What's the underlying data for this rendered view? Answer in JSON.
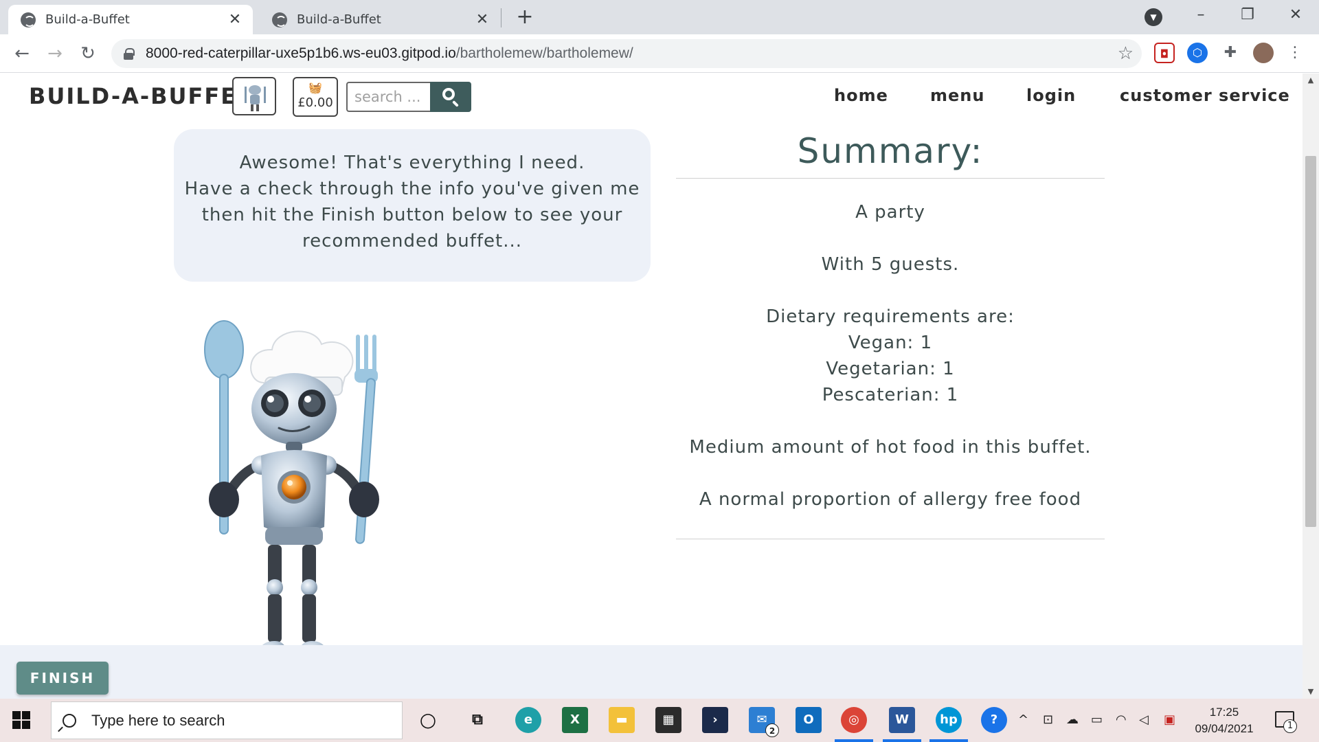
{
  "browser": {
    "tabs": [
      {
        "title": "Build-a-Buffet",
        "active": true
      },
      {
        "title": "Build-a-Buffet",
        "active": false
      }
    ],
    "url_host": "8000-red-caterpillar-uxe5p1b6.ws-eu03.gitpod.io",
    "url_path": "/bartholemew/bartholemew/"
  },
  "site": {
    "brand": "BUILD-A-BUFFET",
    "basket_total": "£0.00",
    "search_placeholder": "search ...",
    "nav": [
      "home",
      "menu",
      "login",
      "customer service"
    ]
  },
  "bubble": {
    "lines": [
      "Awesome! That's everything I need.",
      "Have a check through the info you've given me",
      "then hit the Finish button below to see your",
      "recommended buffet..."
    ]
  },
  "summary": {
    "title": "Summary:",
    "occasion": "A party",
    "guests": "With 5 guests.",
    "dietary_heading": "Dietary requirements are:",
    "dietary": [
      "Vegan: 1",
      "Vegetarian: 1",
      "Pescaterian: 1"
    ],
    "hot_food": "Medium amount of hot food in this buffet.",
    "allergy": "A normal proportion of allergy free food"
  },
  "finish_label": "FINISH",
  "taskbar": {
    "search_placeholder": "Type here to search",
    "time": "17:25",
    "date": "09/04/2021",
    "mail_badge": "2",
    "notification_badge": "1"
  },
  "colors": {
    "accent": "#3e5c5c",
    "finish": "#5f8c88",
    "bubble": "#edf1f8"
  }
}
